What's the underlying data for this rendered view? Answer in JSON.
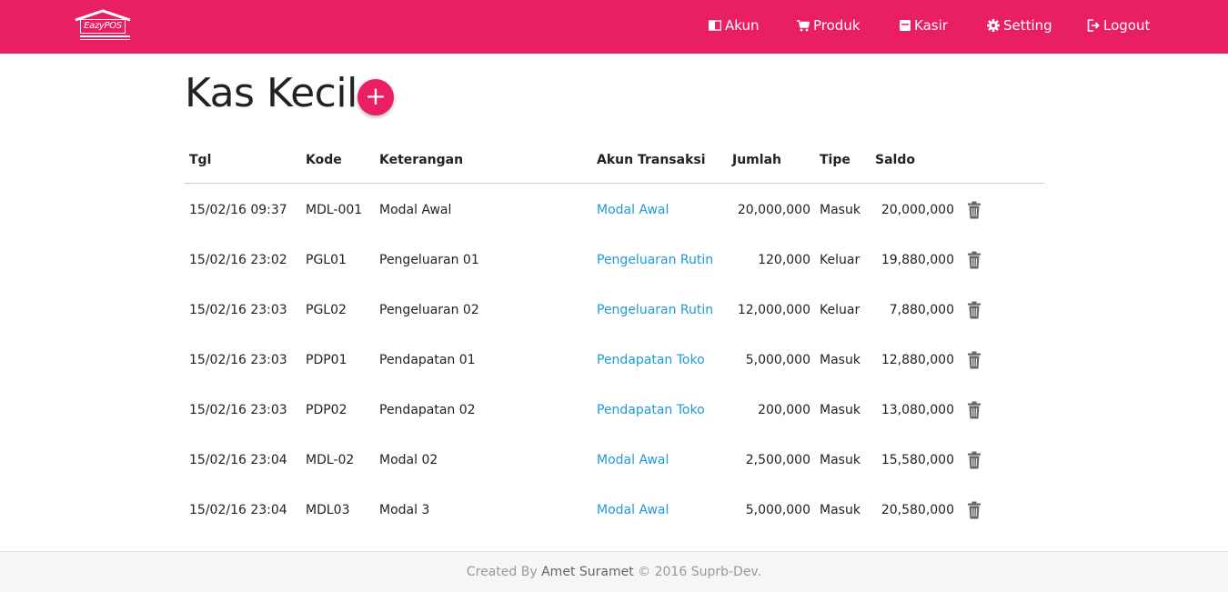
{
  "brand": {
    "name": "EazyPOS",
    "color": "#e91e63"
  },
  "nav": [
    {
      "label": "Akun",
      "icon": "book-icon"
    },
    {
      "label": "Produk",
      "icon": "cart-icon"
    },
    {
      "label": "Kasir",
      "icon": "cash-register-icon"
    },
    {
      "label": "Setting",
      "icon": "gear-icon"
    },
    {
      "label": "Logout",
      "icon": "logout-icon"
    }
  ],
  "page": {
    "title": "Kas Kecil",
    "add_label": "+"
  },
  "table": {
    "headers": [
      "Tgl",
      "Kode",
      "Keterangan",
      "Akun Transaksi",
      "Jumlah",
      "Tipe",
      "Saldo"
    ],
    "rows": [
      {
        "tgl": "15/02/16 09:37",
        "kode": "MDL-001",
        "keterangan": "Modal Awal",
        "akun": "Modal Awal",
        "jumlah": "20,000,000",
        "tipe": "Masuk",
        "saldo": "20,000,000"
      },
      {
        "tgl": "15/02/16 23:02",
        "kode": "PGL01",
        "keterangan": "Pengeluaran 01",
        "akun": "Pengeluaran Rutin",
        "jumlah": "120,000",
        "tipe": "Keluar",
        "saldo": "19,880,000"
      },
      {
        "tgl": "15/02/16 23:03",
        "kode": "PGL02",
        "keterangan": "Pengeluaran 02",
        "akun": "Pengeluaran Rutin",
        "jumlah": "12,000,000",
        "tipe": "Keluar",
        "saldo": "7,880,000"
      },
      {
        "tgl": "15/02/16 23:03",
        "kode": "PDP01",
        "keterangan": "Pendapatan 01",
        "akun": "Pendapatan Toko",
        "jumlah": "5,000,000",
        "tipe": "Masuk",
        "saldo": "12,880,000"
      },
      {
        "tgl": "15/02/16 23:03",
        "kode": "PDP02",
        "keterangan": "Pendapatan 02",
        "akun": "Pendapatan Toko",
        "jumlah": "200,000",
        "tipe": "Masuk",
        "saldo": "13,080,000"
      },
      {
        "tgl": "15/02/16 23:04",
        "kode": "MDL-02",
        "keterangan": "Modal 02",
        "akun": "Modal Awal",
        "jumlah": "2,500,000",
        "tipe": "Masuk",
        "saldo": "15,580,000"
      },
      {
        "tgl": "15/02/16 23:04",
        "kode": "MDL03",
        "keterangan": "Modal 3",
        "akun": "Modal Awal",
        "jumlah": "5,000,000",
        "tipe": "Masuk",
        "saldo": "20,580,000"
      }
    ]
  },
  "footer": {
    "prefix": "Created By",
    "author": "Amet Suramet",
    "suffix": "© 2016 Suprb-Dev."
  }
}
